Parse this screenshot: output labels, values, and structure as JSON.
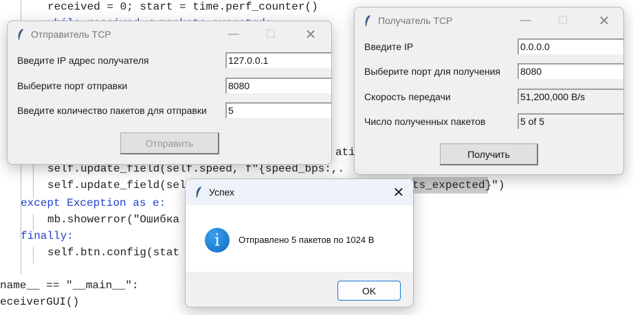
{
  "code": {
    "l0": "received = 0; start = time.perf_counter()",
    "l1": "while received < packets_expected:",
    "l9": "ati",
    "l10": "self.update_field(self.speed, f\"{speed_bps:,.",
    "l11a": "self.update_field(sel",
    "l11b": "ts_expected}\")",
    "l12": "except Exception as e:",
    "l13": "mb.showerror(\"Ошибка",
    "l14": "finally:",
    "l15": "self.btn.config(stat",
    "l17": "name__ == \"__main__\":",
    "l18": "eceiverGUI()"
  },
  "sender": {
    "title": "Отправитель TCP",
    "fields": [
      {
        "label": "Введите IP адрес получателя",
        "value": "127.0.0.1"
      },
      {
        "label": "Выберите порт отправки",
        "value": "8080"
      },
      {
        "label": "Введите количество пакетов для отправки",
        "value": "5"
      }
    ],
    "button": "Отправить"
  },
  "receiver": {
    "title": "Получатель TCP",
    "fields": [
      {
        "label": "Введите IP",
        "value": "0.0.0.0"
      },
      {
        "label": "Выберите порт для получения",
        "value": "8080"
      },
      {
        "label": "Скорость передачи",
        "value": "51,200,000 B/s"
      },
      {
        "label": "Число полученных пакетов",
        "value": "5 of 5"
      }
    ],
    "button": "Получить"
  },
  "dialog": {
    "title": "Успех",
    "message": "Отправлено 5 пакетов по 1024 B",
    "ok": "OK",
    "accent": "#0f78d4"
  }
}
